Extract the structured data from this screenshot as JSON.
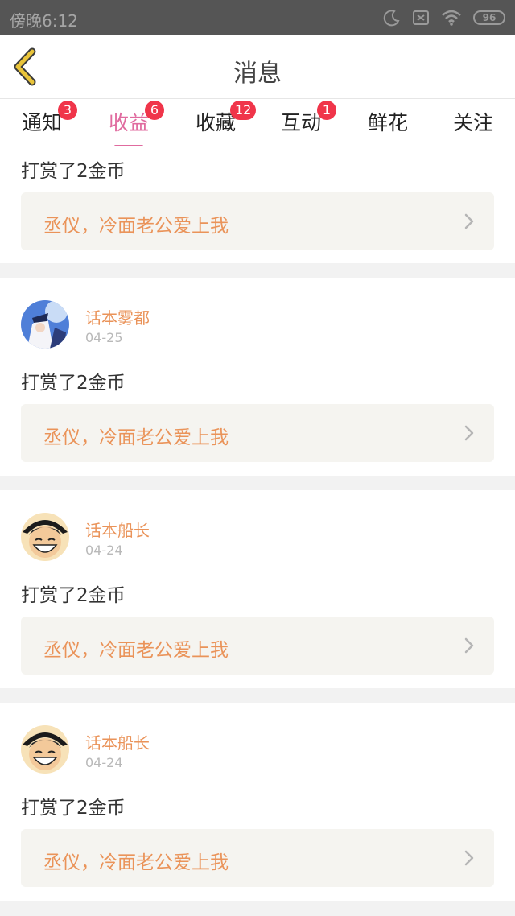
{
  "status_bar": {
    "time": "傍晚6:12",
    "battery": "96",
    "icons": [
      "moon-icon",
      "sim-off-icon",
      "wifi-icon",
      "battery-icon"
    ]
  },
  "header": {
    "back_icon": "chevron-left-icon",
    "title": "消息"
  },
  "tabs": [
    {
      "label": "通知",
      "badge": "3"
    },
    {
      "label": "收益",
      "badge": "6",
      "active": true
    },
    {
      "label": "收藏",
      "badge": "12"
    },
    {
      "label": "互动",
      "badge": "1"
    },
    {
      "label": "鲜花",
      "badge": ""
    },
    {
      "label": "关注",
      "badge": ""
    }
  ],
  "feed": {
    "partial_card": {
      "text": "打赏了2金币",
      "book": "丞仪，冷面老公爱上我"
    },
    "cards": [
      {
        "user": "话本雾都",
        "date": "04-25",
        "text": "打赏了2金币",
        "book": "丞仪，冷面老公爱上我",
        "avatar": "anime-avatar-blue"
      },
      {
        "user": "话本船长",
        "date": "04-24",
        "text": "打赏了2金币",
        "book": "丞仪，冷面老公爱上我",
        "avatar": "anime-avatar-straw-hat"
      },
      {
        "user": "话本船长",
        "date": "04-24",
        "text": "打赏了2金币",
        "book": "丞仪，冷面老公爱上我",
        "avatar": "anime-avatar-straw-hat"
      }
    ]
  },
  "colors": {
    "accent_tab": "#e06b9f",
    "badge": "#f0354a",
    "username": "#ea9359",
    "book_title": "#ea9359",
    "back_icon": "#e9c43a"
  }
}
